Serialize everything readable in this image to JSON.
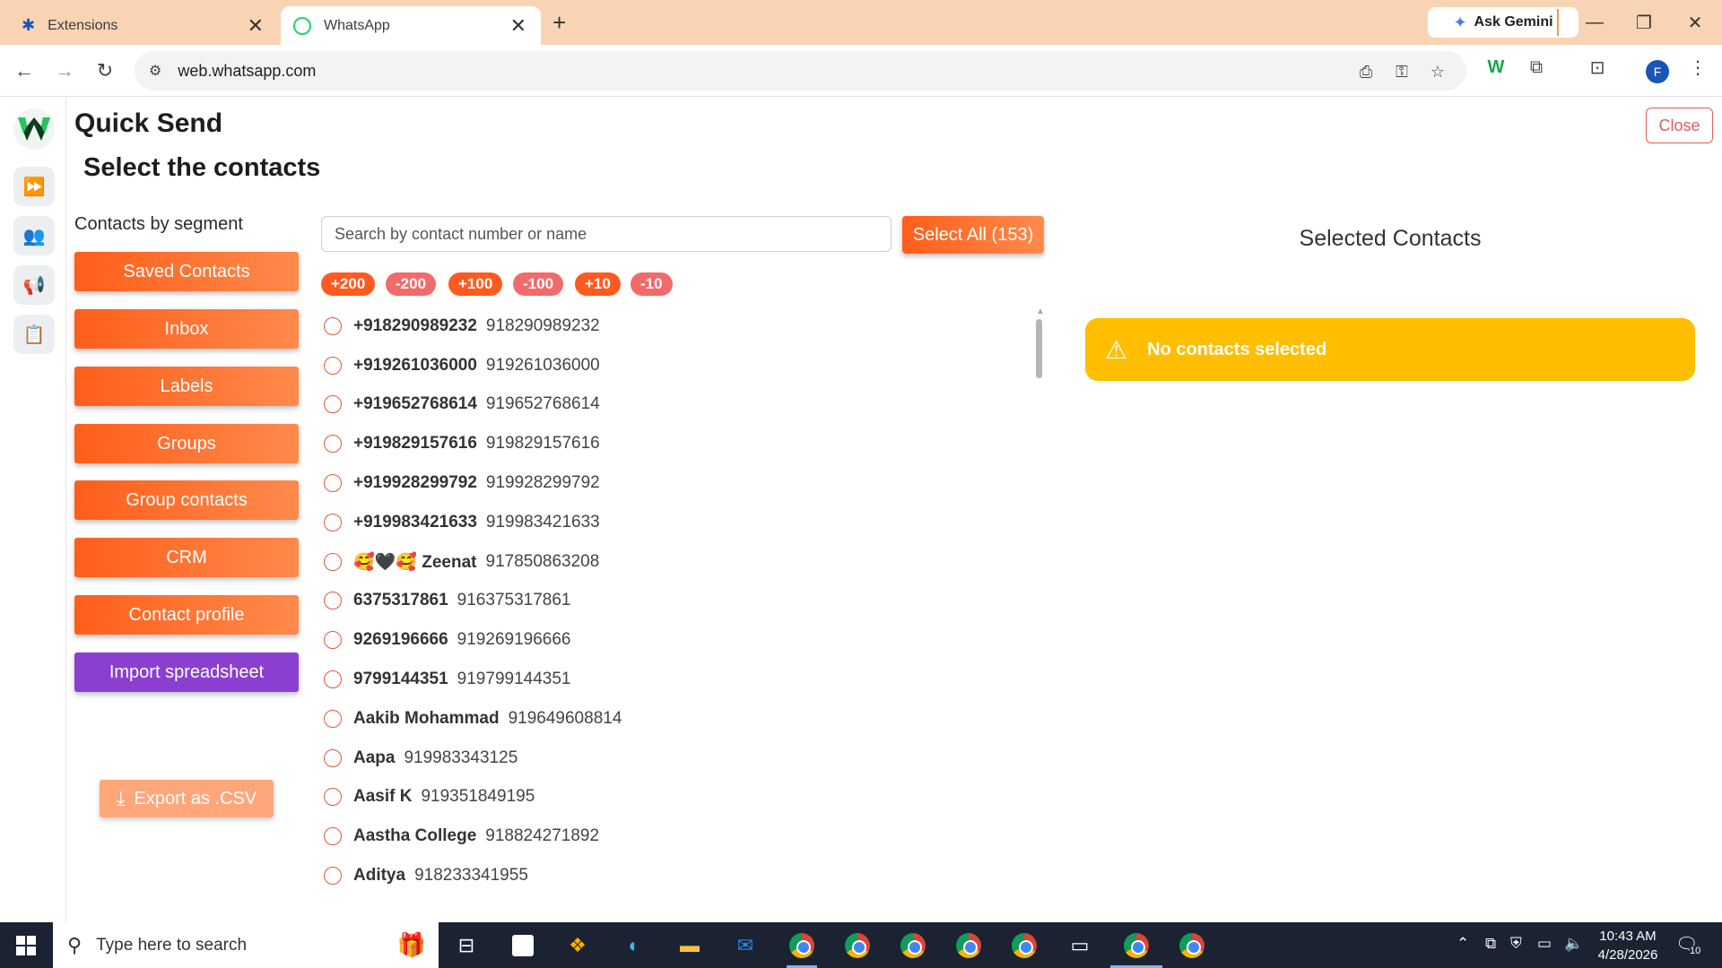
{
  "browser": {
    "tabs": [
      {
        "title": "Extensions",
        "close": "✕"
      },
      {
        "title": "WhatsApp",
        "close": "✕"
      }
    ],
    "new_tab": "+",
    "ask_gemini": "Ask Gemini",
    "url": "web.whatsapp.com",
    "profile_initial": "F"
  },
  "app": {
    "title": "Quick Send",
    "subtitle": "Select the contacts",
    "close_label": "Close",
    "segment_label": "Contacts by segment",
    "segments": [
      {
        "label": "Saved Contacts"
      },
      {
        "label": "Inbox"
      },
      {
        "label": "Labels"
      },
      {
        "label": "Groups"
      },
      {
        "label": "Group contacts"
      },
      {
        "label": "CRM"
      },
      {
        "label": "Contact profile"
      },
      {
        "label": "Import spreadsheet"
      }
    ],
    "export_label": "Export as .CSV",
    "search_placeholder": "Search by contact number or name",
    "select_all_label": "Select All (153)",
    "chips": [
      "+200",
      "-200",
      "+100",
      "-100",
      "+10",
      "-10"
    ],
    "contacts": [
      {
        "name": "+918290989232",
        "number": "918290989232"
      },
      {
        "name": "+919261036000",
        "number": "919261036000"
      },
      {
        "name": "+919652768614",
        "number": "919652768614"
      },
      {
        "name": "+919829157616",
        "number": "919829157616"
      },
      {
        "name": "+919928299792",
        "number": "919928299792"
      },
      {
        "name": "+919983421633",
        "number": "919983421633"
      },
      {
        "name": "🥰🖤🥰 Zeenat",
        "number": "917850863208"
      },
      {
        "name": "6375317861",
        "number": "916375317861"
      },
      {
        "name": "9269196666",
        "number": "919269196666"
      },
      {
        "name": "9799144351",
        "number": "919799144351"
      },
      {
        "name": "Aakib Mohammad",
        "number": "919649608814"
      },
      {
        "name": "Aapa",
        "number": "919983343125"
      },
      {
        "name": "Aasif K",
        "number": "919351849195"
      },
      {
        "name": "Aastha College",
        "number": "918824271892"
      },
      {
        "name": "Aditya",
        "number": "918233341955"
      }
    ],
    "selected_title": "Selected Contacts",
    "empty_message": "No contacts selected",
    "colors": {
      "accent": "#ff5e1a",
      "purple": "#8a3fd1",
      "warning": "#ffbe00",
      "close": "#e35b5b"
    }
  },
  "taskbar": {
    "search_placeholder": "Type here to search",
    "time": "10:43 AM",
    "date": "4/28/2026",
    "notification_count": "10"
  }
}
